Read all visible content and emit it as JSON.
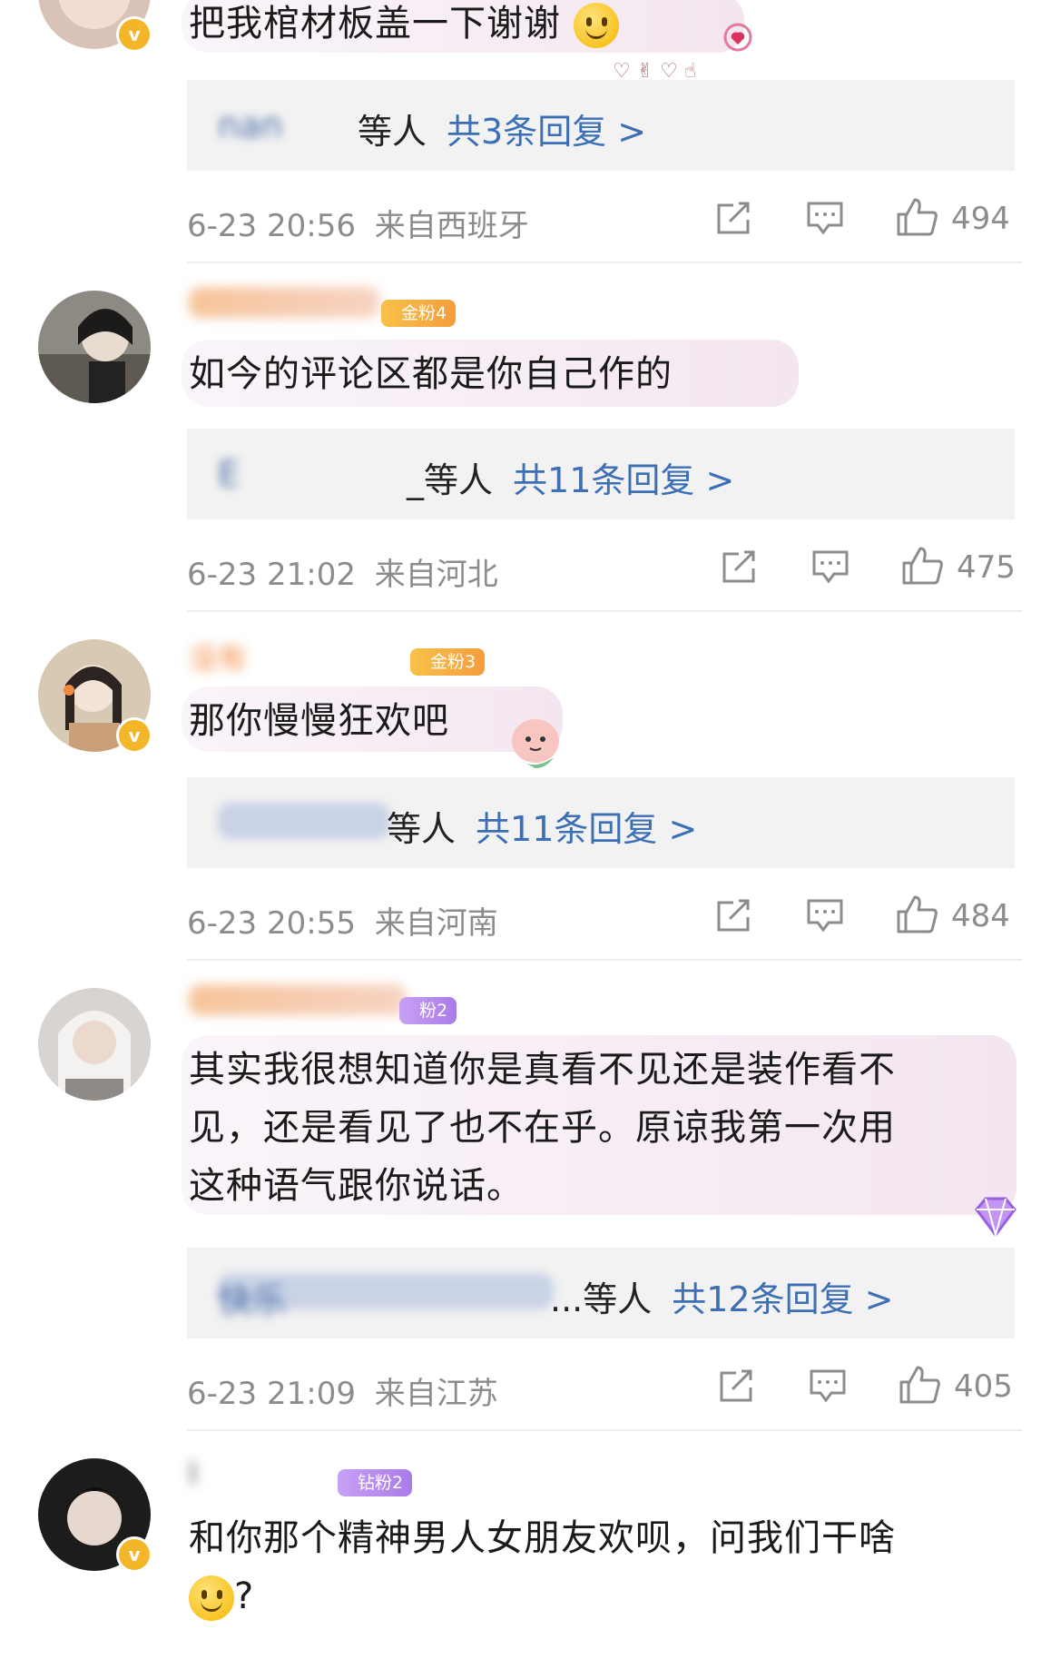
{
  "comments": [
    {
      "text": "把我棺材板盖一下谢谢",
      "reply_names": "nan",
      "reply_by": "等人",
      "reply_count": "共3条回复 >",
      "time": "6-23 20:56",
      "location": "来自西班牙",
      "likes": "494"
    },
    {
      "fan_badge": "金粉4",
      "text": "如今的评论区都是你自己作的",
      "reply_names": "E",
      "reply_by": "_等人",
      "reply_count": "共11条回复 >",
      "time": "6-23 21:02",
      "location": "来自河北",
      "likes": "475"
    },
    {
      "username": "没有",
      "fan_badge": "金粉3",
      "text": "那你慢慢狂欢吧",
      "reply_names": "",
      "reply_by": "等人",
      "reply_count": "共11条回复 >",
      "time": "6-23 20:55",
      "location": "来自河南",
      "likes": "484"
    },
    {
      "fan_badge": "粉2",
      "text_lines": [
        "其实我很想知道你是真看不见还是装作看不",
        "见，还是看见了也不在乎。原谅我第一次用",
        "这种语气跟你说话。"
      ],
      "reply_names": "快乐",
      "reply_by": "...等人",
      "reply_count": "共12条回复 >",
      "time": "6-23 21:09",
      "location": "来自江苏",
      "likes": "405"
    },
    {
      "username": "l",
      "fan_badge": "钻粉2",
      "text_lines": [
        "和你那个精神男人女朋友欢呗，问我们干啥",
        "?"
      ]
    }
  ],
  "icons": {
    "repost": "repost-icon",
    "comment": "comment-icon",
    "like": "thumbs-up-icon",
    "verified": "verified-v-icon",
    "emoji": "smiley-emoji"
  },
  "colors": {
    "link": "#3d6fb5",
    "meta": "#8c8c8c",
    "verified": "#f3b629"
  },
  "badges": {
    "verified": "v"
  }
}
